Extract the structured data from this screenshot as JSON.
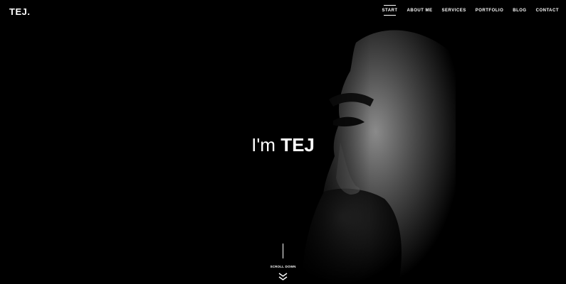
{
  "header": {
    "logo": "TEJ.",
    "nav": [
      {
        "label": "START",
        "active": true
      },
      {
        "label": "ABOUT ME",
        "active": false
      },
      {
        "label": "SERVICES",
        "active": false
      },
      {
        "label": "PORTFOLIO",
        "active": false
      },
      {
        "label": "BLOG",
        "active": false
      },
      {
        "label": "CONTACT",
        "active": false
      }
    ]
  },
  "hero": {
    "headline_prefix": "I'm",
    "headline_name": "TEJ",
    "background_color": "#000000"
  },
  "scroll": {
    "label": "SCROLL DOWN",
    "icon": "double-chevron-down-icon"
  }
}
